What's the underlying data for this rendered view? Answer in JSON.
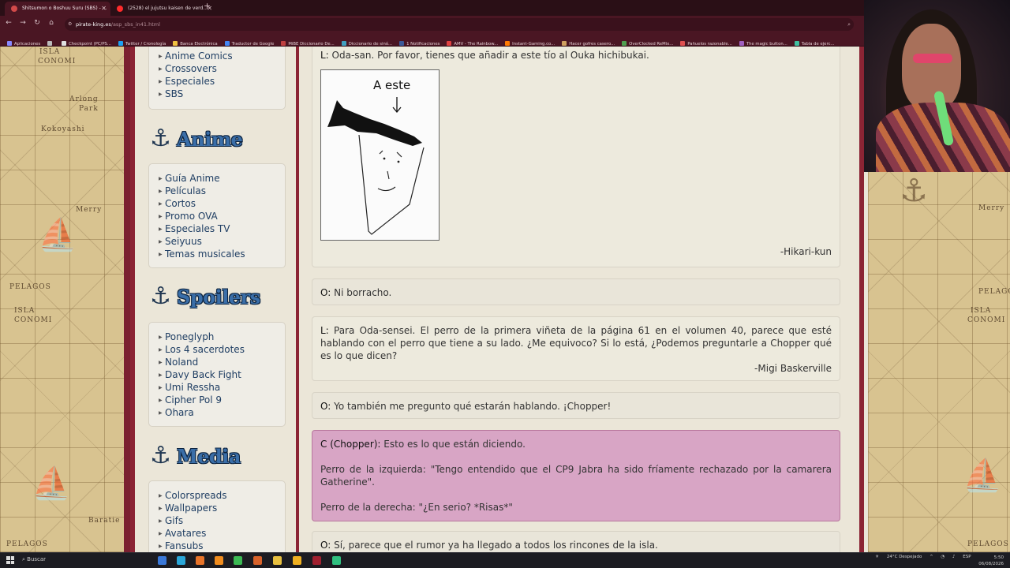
{
  "browser": {
    "tabs": [
      {
        "label": "Shitsumon o Boshuu Suru (SBS) - ...",
        "favicon_color": "#d24a4a"
      },
      {
        "label": "(2528) el jujutsu kaisen de verd...",
        "favicon_color": "#ff2b2b"
      }
    ],
    "url_domain": "pirate-king.es",
    "url_path": "/asp_sbs_in41.html",
    "bookmarks": [
      {
        "label": "Aplicaciones",
        "color": "#8888ff"
      },
      {
        "label": "",
        "color": "#bbbbbb"
      },
      {
        "label": "Checkpoint (PC/PS...",
        "color": "#e0e0e0"
      },
      {
        "label": "Twitter / Cronología",
        "color": "#1da1f2"
      },
      {
        "label": "Banca Electrónica",
        "color": "#f0c040"
      },
      {
        "label": "Traductor de Google",
        "color": "#4285f4"
      },
      {
        "label": "MiBE Diccionario De...",
        "color": "#c04040"
      },
      {
        "label": "Diccionario de sinó...",
        "color": "#40a0c0"
      },
      {
        "label": "1 Notificaciones",
        "color": "#3b5998"
      },
      {
        "label": "AMV - The Rainbow...",
        "color": "#e04040"
      },
      {
        "label": "Instant-Gaming.co...",
        "color": "#ff7a00"
      },
      {
        "label": "Hacer gofres casero...",
        "color": "#d0a060"
      },
      {
        "label": "OverClocked ReMix...",
        "color": "#50a050"
      },
      {
        "label": "Pañuelos razonable...",
        "color": "#e05050"
      },
      {
        "label": "The magic button...",
        "color": "#a060c0"
      },
      {
        "label": "Tabla de ejerc...",
        "color": "#40c0a0"
      }
    ]
  },
  "map": {
    "labels_left": [
      "ISLA",
      "CONOMI",
      "Arlong",
      "Park",
      "Kokoyashi",
      "Merry",
      "PELAGOS",
      "Baratie"
    ],
    "labels_right": [
      "Merry",
      "PELAGOS",
      "ISLA",
      "CONOMI",
      "PELAGOS"
    ]
  },
  "sidebar": {
    "box1_items": [
      "Anime Comics",
      "Crossovers",
      "Especiales",
      "SBS"
    ],
    "anime_title": "Anime",
    "anime_items": [
      "Guía Anime",
      "Películas",
      "Cortos",
      "Promo OVA",
      "Especiales TV",
      "Seiyuus",
      "Temas musicales"
    ],
    "spoilers_title": "Spoilers",
    "spoilers_items": [
      "Poneglyph",
      "Los 4 sacerdotes",
      "Noland",
      "Davy Back Fight",
      "Umi Ressha",
      "Cipher Pol 9",
      "Ohara"
    ],
    "media_title": "Media",
    "media_items": [
      "Colorspreads",
      "Wallpapers",
      "Gifs",
      "Avatares",
      "Fansubs"
    ]
  },
  "sbs": {
    "q1": {
      "speaker": "L:",
      "text": " Oda-san. Por favor, tienes que añadir a este tío al Ouka hichibukai.",
      "drawing_caption": "A este",
      "signature": "-Hikari-kun"
    },
    "a1": {
      "speaker": "O:",
      "text": " Ni borracho."
    },
    "q2": {
      "speaker": "L:",
      "text": " Para Oda-sensei. El perro de la primera viñeta de la página 61 en el volumen 40, parece que esté hablando con el perro que tiene a su lado. ¿Me equivoco? Si lo está, ¿Podemos preguntarle a Chopper qué es lo que dicen?",
      "signature": "-Migi Baskerville"
    },
    "a2": {
      "speaker": "O:",
      "text": " Yo también me pregunto qué estarán hablando. ¡Chopper!"
    },
    "c": {
      "speaker": "C (Chopper):",
      "text": " Esto es lo que están diciendo.",
      "line2": "Perro de la izquierda: \"Tengo entendido que el CP9 Jabra ha sido fríamente rechazado por la camarera Gatherine\".",
      "line3": "Perro de la derecha: \"¿En serio? *Risas*\""
    },
    "a3": {
      "speaker": "O:",
      "text": " Sí, parece que el rumor ya ha llegado a todos los rincones de la isla."
    }
  },
  "taskbar": {
    "search_label": "Buscar",
    "weather": "24°C  Despejado",
    "language": "ESP",
    "time": "5:50",
    "date": "06/08/2026",
    "apps": [
      {
        "name": "files-app",
        "color": "#3a78d8"
      },
      {
        "name": "edge-app",
        "color": "#2aa6d8"
      },
      {
        "name": "firefox-app",
        "color": "#e8742a"
      },
      {
        "name": "vlc-app",
        "color": "#f08c1e"
      },
      {
        "name": "chrome-app",
        "color": "#3cba54"
      },
      {
        "name": "app-orange",
        "color": "#d8622a"
      },
      {
        "name": "folder-app",
        "color": "#e8c040"
      },
      {
        "name": "app-yellow",
        "color": "#f0b020"
      },
      {
        "name": "browser-active-app",
        "color": "#a02030"
      },
      {
        "name": "obs-app",
        "color": "#30c080"
      }
    ]
  }
}
